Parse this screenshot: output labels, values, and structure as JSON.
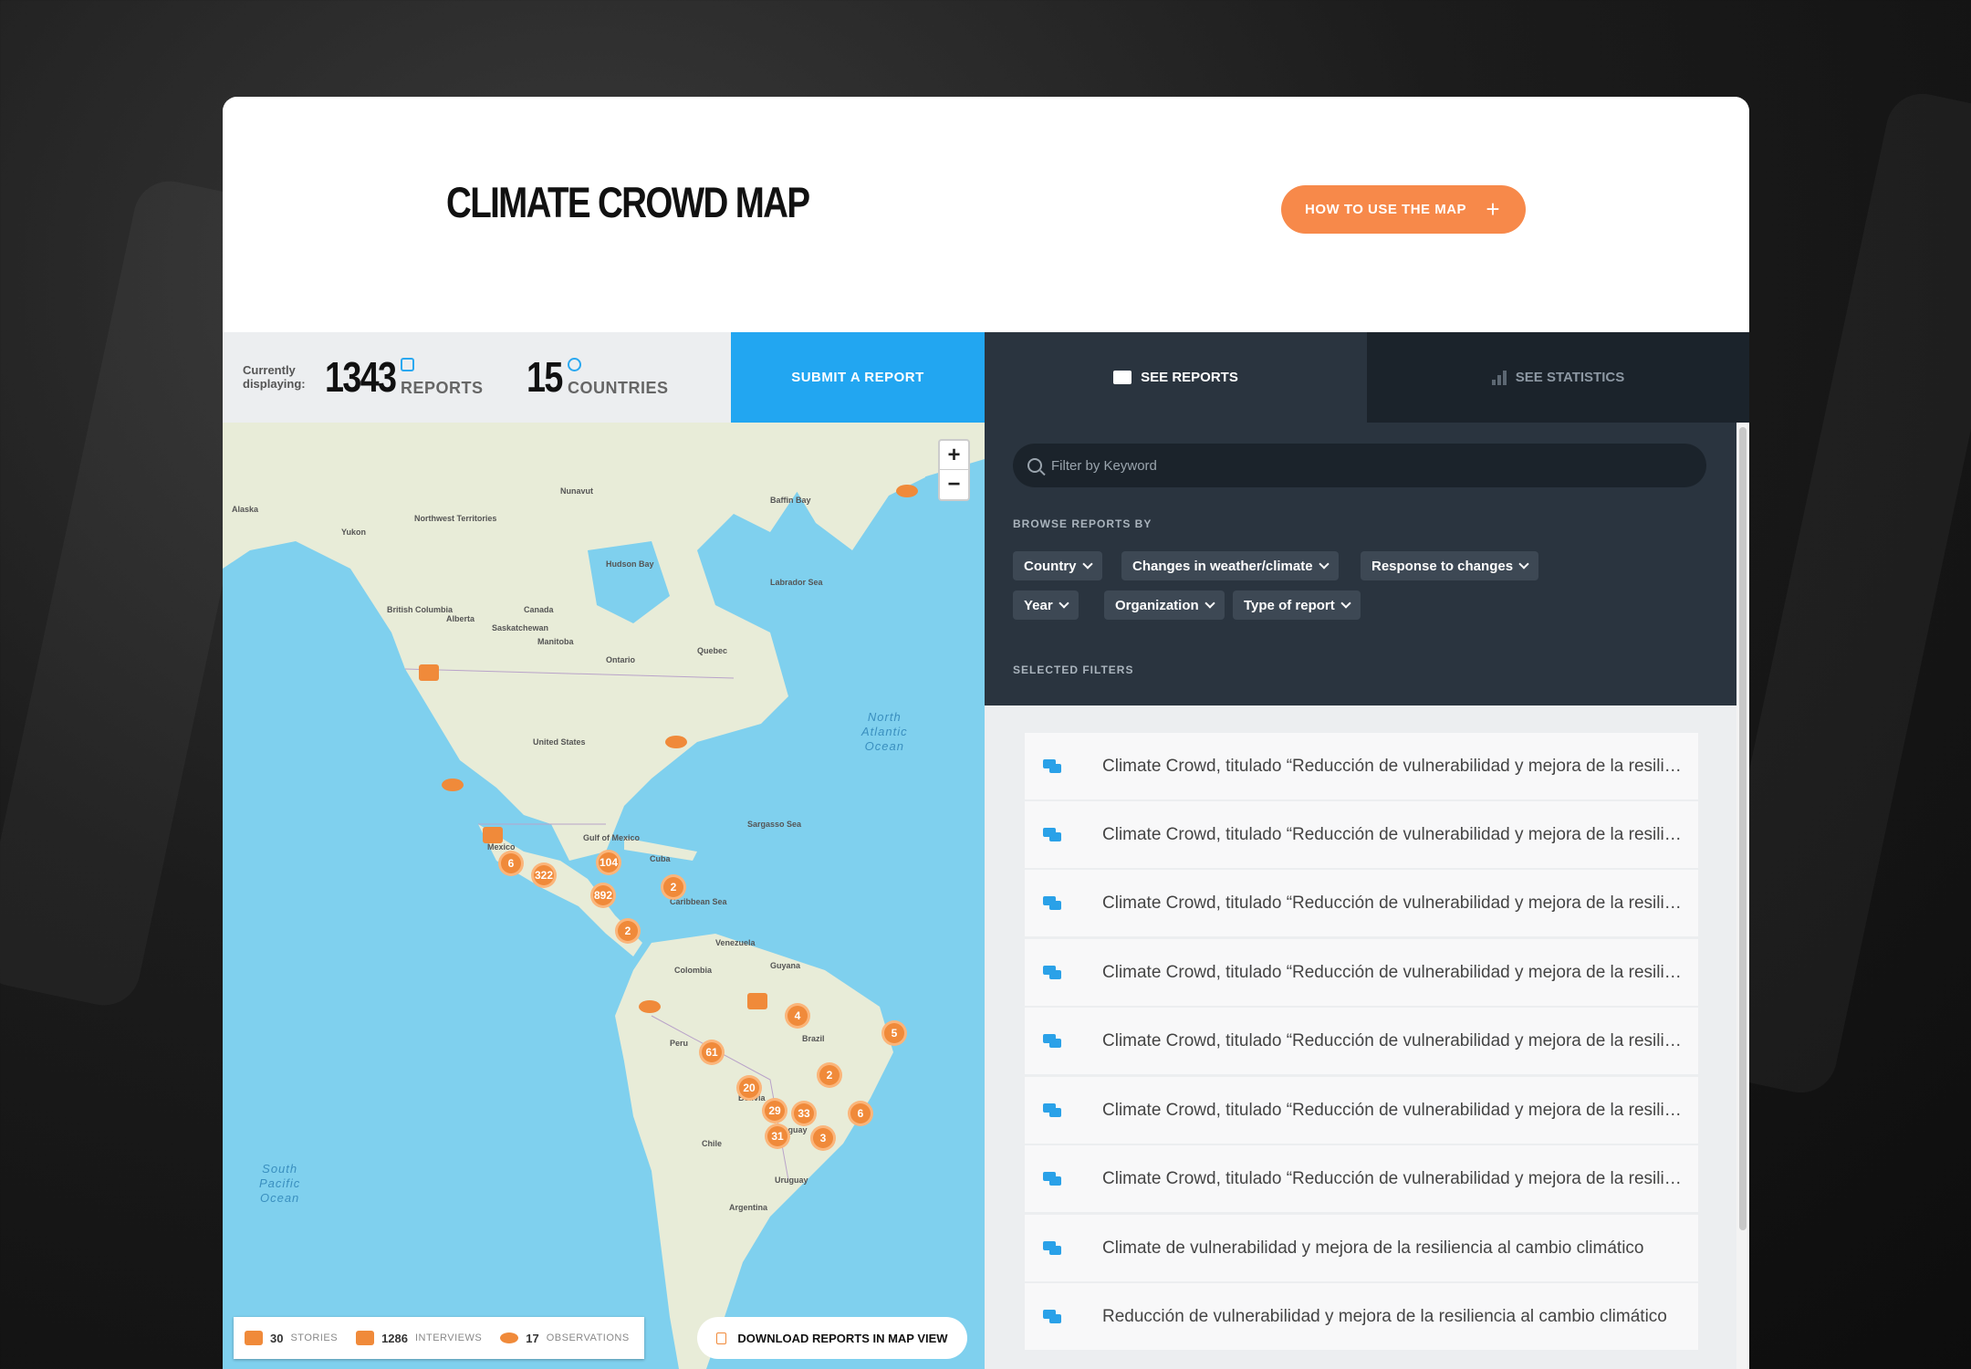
{
  "header": {
    "title": "CLIMATE CROWD MAP",
    "how_button": "HOW TO USE THE MAP",
    "how_button_icon": "plus-icon"
  },
  "stats": {
    "currently_line1": "Currently",
    "currently_line2": "displaying:",
    "reports_count": "1343",
    "reports_label": "REPORTS",
    "countries_count": "15",
    "countries_label": "COUNTRIES"
  },
  "submit_button": "SUBMIT A REPORT",
  "tabs": {
    "reports": "SEE REPORTS",
    "statistics": "SEE STATISTICS"
  },
  "filters": {
    "search_placeholder": "Filter by Keyword",
    "browse_label": "BROWSE REPORTS BY",
    "selected_label": "SELECTED FILTERS",
    "chips": [
      "Country",
      "Changes in weather/climate",
      "Response to changes",
      "Year",
      "Organization",
      "Type of report"
    ]
  },
  "map": {
    "zoom_in": "+",
    "zoom_out": "−",
    "clusters": [
      "6",
      "322",
      "104",
      "2",
      "892",
      "2",
      "4",
      "5",
      "61",
      "2",
      "20",
      "29",
      "33",
      "6",
      "31",
      "3"
    ],
    "ocean_labels": {
      "north_atlantic": "North\nAtlantic\nOcean",
      "south_pacific": "South\nPacific\nOcean"
    },
    "place_labels": [
      "Canada",
      "United States",
      "Mexico",
      "Venezuela",
      "Colombia",
      "Peru",
      "Brazil",
      "Bolivia",
      "Chile",
      "Argentina",
      "Cuba",
      "Uruguay",
      "Paraguay",
      "Guyana",
      "Alaska",
      "Yukon",
      "Ontario",
      "Quebec",
      "Alberta",
      "Manitoba",
      "Saskatchewan",
      "British Columbia",
      "Nunavut",
      "Northwest Territories",
      "Hudson Bay",
      "Baffin Bay",
      "Labrador Sea",
      "Sargasso Sea",
      "Caribbean Sea",
      "Gulf of Mexico"
    ],
    "legend": {
      "stories_count": "30",
      "stories_label": "STORIES",
      "interviews_count": "1286",
      "interviews_label": "INTERVIEWS",
      "observations_count": "17",
      "observations_label": "OBSERVATIONS"
    },
    "download_button": "DOWNLOAD REPORTS IN MAP VIEW"
  },
  "reports": [
    "Climate Crowd, titulado “Reducción de vulnerabilidad y mejora de la resiliencia al cambio climático”",
    "Climate Crowd, titulado “Reducción de vulnerabilidad y mejora de la resiliencia al cambio climático”",
    "Climate Crowd, titulado “Reducción de vulnerabilidad y mejora de la resiliencia al cambio climático”",
    "Climate Crowd, titulado “Reducción de vulnerabilidad y mejora de la resiliencia al cambio climático”",
    "Climate Crowd, titulado “Reducción de vulnerabilidad y mejora de la resiliencia al cambio climático”",
    "Climate Crowd, titulado “Reducción de vulnerabilidad y mejora de la resiliencia al cambio climático”",
    "Climate Crowd, titulado “Reducción de vulnerabilidad y mejora de la resiliencia al cambio climático”",
    "Climate de vulnerabilidad y mejora de la resiliencia al cambio climático",
    "Reducción de vulnerabilidad y mejora de la resiliencia al cambio climático"
  ],
  "colors": {
    "accent_orange": "#f7894a",
    "submit_blue": "#22a6f1",
    "panel_dark": "#2a343f",
    "tab_dark": "#1b232b",
    "ocean": "#7fd0ee",
    "land": "#e8ecd8"
  }
}
